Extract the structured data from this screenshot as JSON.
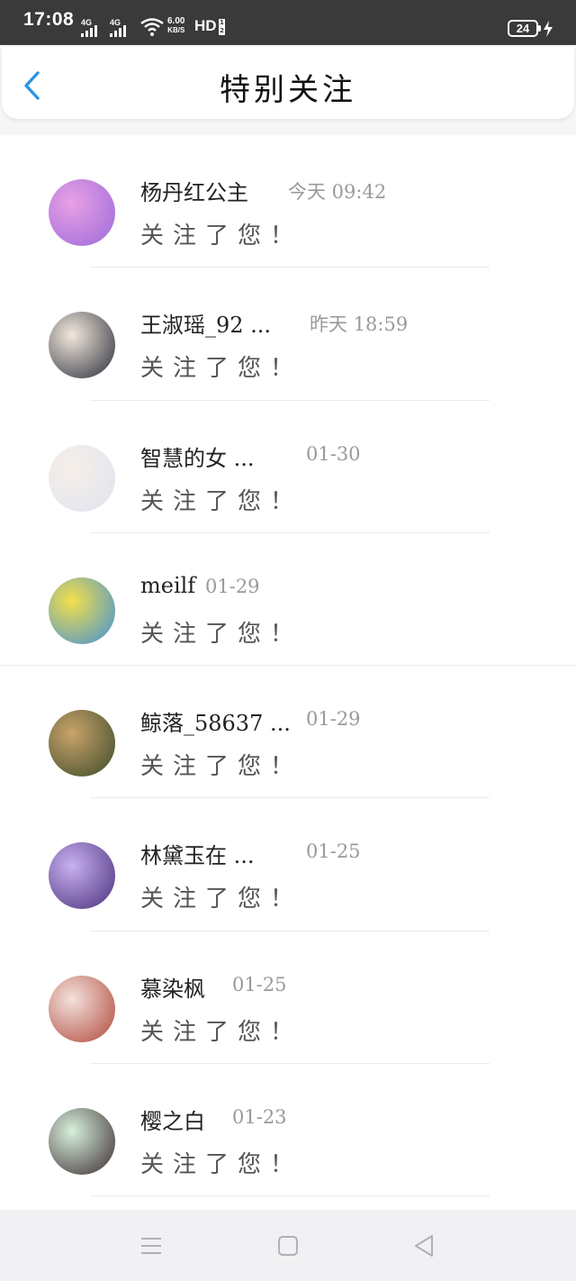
{
  "status_bar": {
    "time": "17:08",
    "signal_1_tag": "4G",
    "signal_2_tag": "4G",
    "net_speed_value": "6.00",
    "net_speed_unit": "KB/S",
    "hd_label": "HD",
    "battery_level": "24"
  },
  "header": {
    "title": "特别关注",
    "back_icon": "chevron-left-icon",
    "accent_color": "#2a95e8"
  },
  "items": [
    {
      "name": "杨丹红公主",
      "time": "今天 09:42",
      "message": "关注了您！",
      "avatar_colors": [
        "#e9a0e6",
        "#9a6ad8"
      ]
    },
    {
      "name": "王淑瑶_92 ...",
      "time": "昨天 18:59",
      "message": "关注了您！",
      "avatar_colors": [
        "#f2e8dc",
        "#2a2d3a"
      ]
    },
    {
      "name": "智慧的女 ...",
      "time": "01-30",
      "message": "关注了您！",
      "avatar_colors": [
        "#f6efe8",
        "#dfe3f0"
      ]
    },
    {
      "name": "meilf",
      "time": "01-29",
      "message": "关注了您！",
      "avatar_colors": [
        "#f4e04a",
        "#3f8fd8"
      ]
    },
    {
      "name": "鲸落_58637 ...",
      "time": "01-29",
      "message": "关注了您！",
      "avatar_colors": [
        "#c9a36a",
        "#3b4a2a"
      ]
    },
    {
      "name": "林黛玉在 ...",
      "time": "01-25",
      "message": "关注了您！",
      "avatar_colors": [
        "#c8b0f0",
        "#4a2f7a"
      ]
    },
    {
      "name": "慕染枫",
      "time": "01-25",
      "message": "关注了您！",
      "avatar_colors": [
        "#f3e2dc",
        "#b0473a"
      ]
    },
    {
      "name": "樱之白",
      "time": "01-23",
      "message": "关注了您！",
      "avatar_colors": [
        "#d8f0dc",
        "#3a2a30"
      ]
    }
  ],
  "nav_bar": {
    "menu_icon": "menu-icon",
    "home_icon": "home-square-icon",
    "back_icon": "back-triangle-icon"
  }
}
